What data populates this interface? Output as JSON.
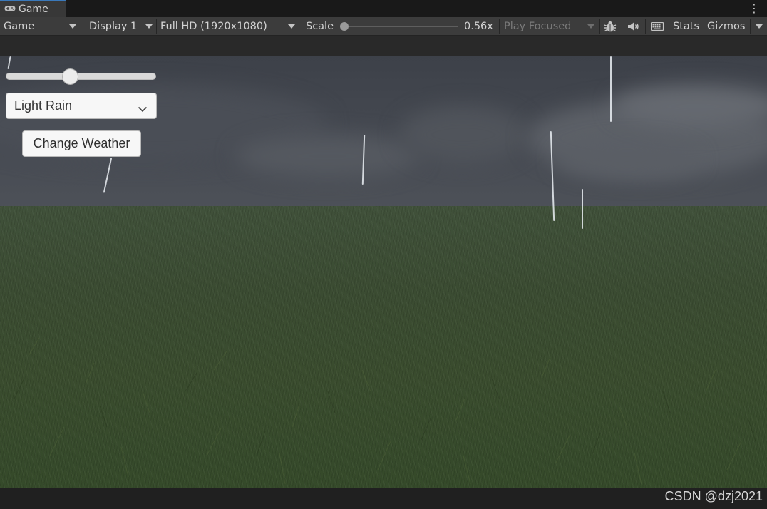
{
  "tab": {
    "label": "Game"
  },
  "toolbar": {
    "view_mode": "Game",
    "display": "Display 1",
    "resolution": "Full HD (1920x1080)",
    "scale_label": "Scale",
    "scale_value": "0.56x",
    "scale_fraction": 0.0,
    "play_mode": "Play Focused",
    "stats_label": "Stats",
    "gizmos_label": "Gizmos"
  },
  "game_ui": {
    "slider_fraction": 0.42,
    "weather_dropdown": {
      "selected": "Light Rain"
    },
    "change_weather_label": "Change Weather"
  },
  "icons": [
    "gamepad-icon",
    "more-options-icon",
    "bug-icon",
    "audio-icon",
    "keyboard-icon",
    "chevron-down-icon"
  ],
  "colors": {
    "tab_accent": "#3a79bb",
    "toolbar_bg": "#3c3c3c",
    "button_bg": "#f7f7f7"
  },
  "watermark": "CSDN @dzj2021"
}
